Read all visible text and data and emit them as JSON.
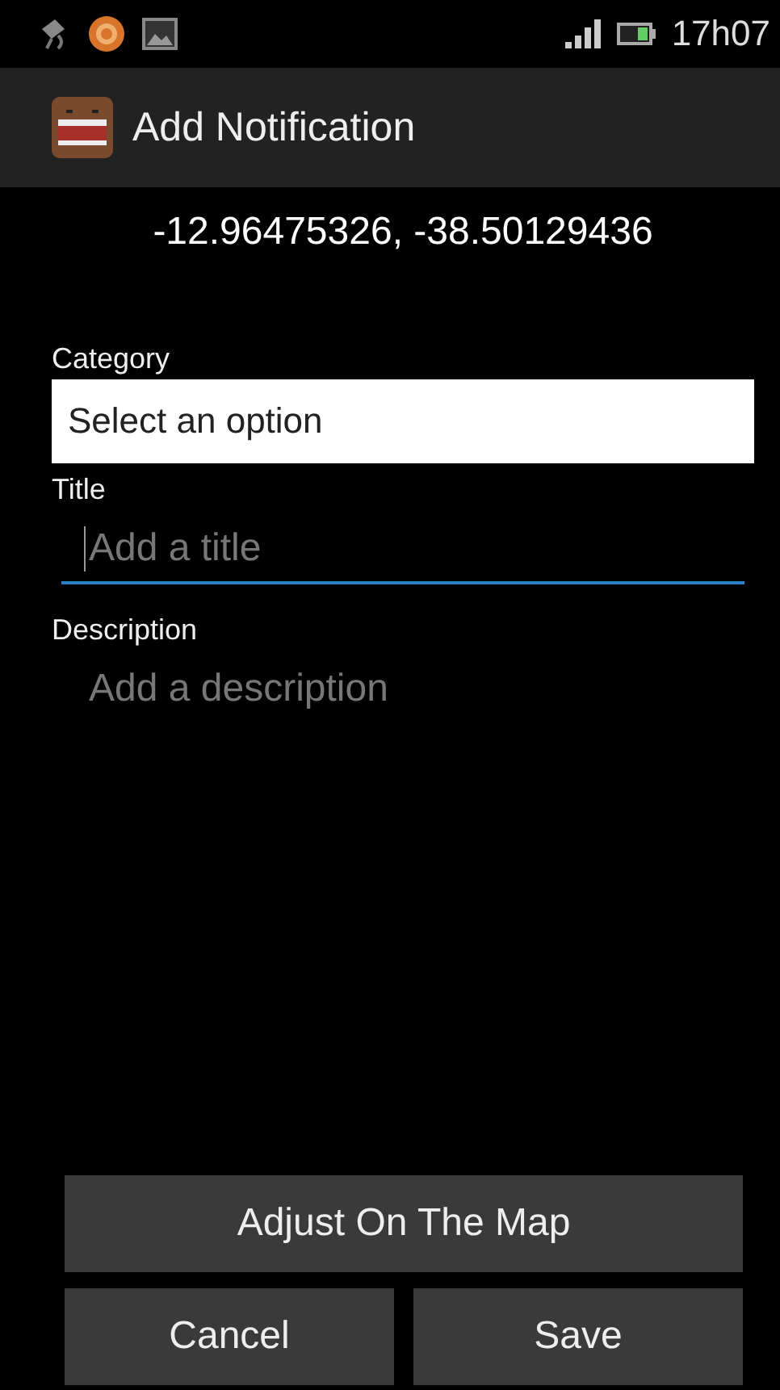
{
  "status_bar": {
    "time": "17h07"
  },
  "action_bar": {
    "title": "Add Notification"
  },
  "coordinates": "-12.96475326, -38.50129436",
  "category": {
    "label": "Category",
    "value": "Select an option"
  },
  "fields": [
    {
      "label": "Title",
      "placeholder": "Add a title",
      "focused": true
    },
    {
      "label": "Description",
      "placeholder": "Add a description",
      "focused": false
    }
  ],
  "buttons": [
    {
      "label": "Adjust On The Map",
      "kind": "wide"
    },
    {
      "label": "Cancel",
      "kind": "half"
    },
    {
      "label": "Save",
      "kind": "half"
    }
  ]
}
